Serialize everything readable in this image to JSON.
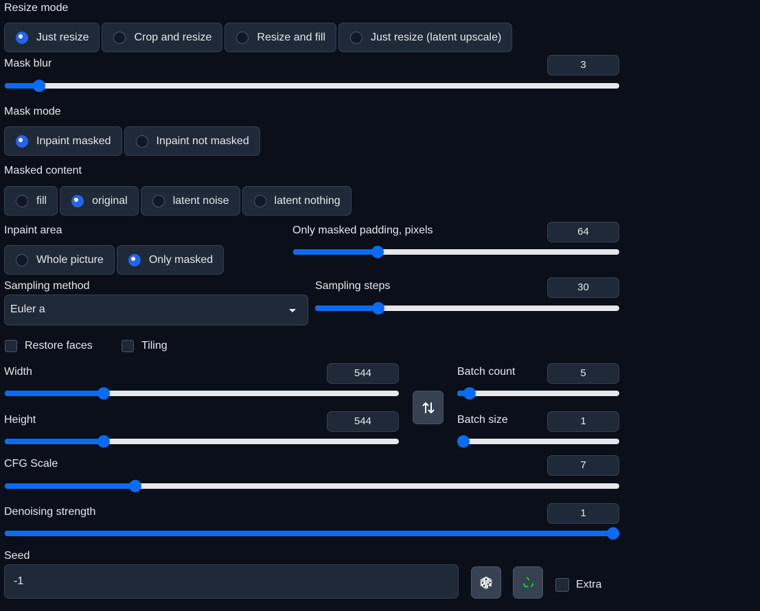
{
  "resize_mode": {
    "label": "Resize mode",
    "options": [
      "Just resize",
      "Crop and resize",
      "Resize and fill",
      "Just resize (latent upscale)"
    ],
    "selected": "Just resize"
  },
  "mask_blur": {
    "label": "Mask blur",
    "value": "3",
    "min": 0,
    "max": 64
  },
  "mask_mode": {
    "label": "Mask mode",
    "options": [
      "Inpaint masked",
      "Inpaint not masked"
    ],
    "selected": "Inpaint masked"
  },
  "masked_content": {
    "label": "Masked content",
    "options": [
      "fill",
      "original",
      "latent noise",
      "latent nothing"
    ],
    "selected": "original"
  },
  "inpaint_area": {
    "label": "Inpaint area",
    "options": [
      "Whole picture",
      "Only masked"
    ],
    "selected": "Only masked"
  },
  "only_masked_padding": {
    "label": "Only masked padding, pixels",
    "value": "64",
    "min": 0,
    "max": 256
  },
  "sampling_method": {
    "label": "Sampling method",
    "value": "Euler a"
  },
  "sampling_steps": {
    "label": "Sampling steps",
    "value": "30",
    "min": 1,
    "max": 150
  },
  "restore_faces": {
    "label": "Restore faces",
    "checked": false
  },
  "tiling": {
    "label": "Tiling",
    "checked": false
  },
  "width": {
    "label": "Width",
    "value": "544",
    "min": 64,
    "max": 2048
  },
  "height": {
    "label": "Height",
    "value": "544",
    "min": 64,
    "max": 2048
  },
  "batch_count": {
    "label": "Batch count",
    "value": "5",
    "min": 1,
    "max": 100
  },
  "batch_size": {
    "label": "Batch size",
    "value": "1",
    "min": 1,
    "max": 8
  },
  "swap_icon": "swap-vertical-arrows-icon",
  "cfg_scale": {
    "label": "CFG Scale",
    "value": "7",
    "min": 1,
    "max": 30
  },
  "denoising_strength": {
    "label": "Denoising strength",
    "value": "1",
    "min": 0,
    "max": 1
  },
  "seed": {
    "label": "Seed",
    "value": "-1",
    "random_icon": "dice-icon",
    "reuse_icon": "recycle-icon"
  },
  "extra": {
    "label": "Extra",
    "checked": false
  },
  "colors": {
    "accent": "#0a6cf5",
    "background": "#0b0f19",
    "panel": "#1f2937",
    "border": "#374151"
  }
}
